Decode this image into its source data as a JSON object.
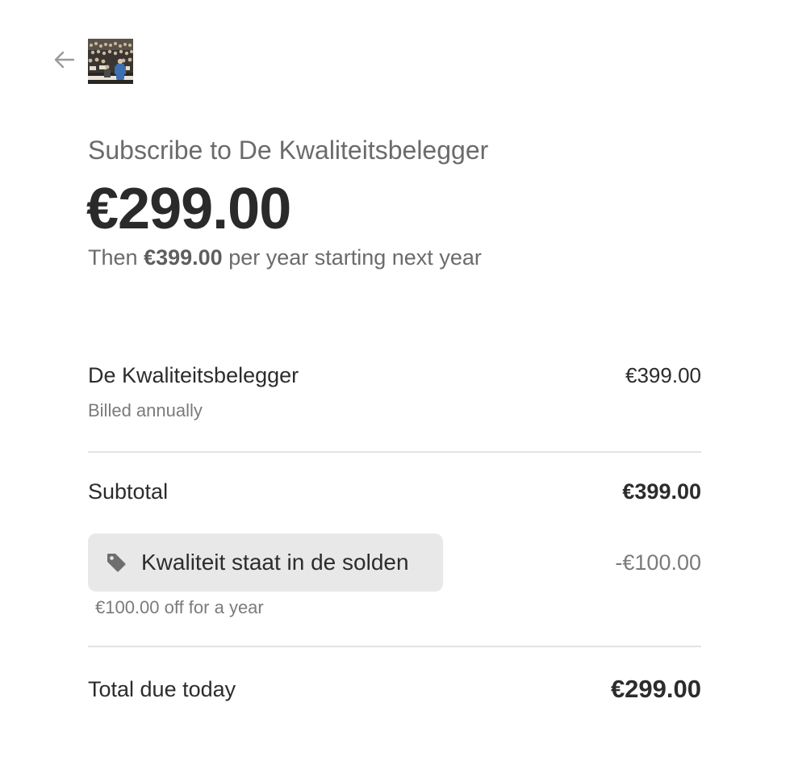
{
  "header": {
    "back_icon": "arrow-left-icon",
    "logo_icon": "crowd-photo-logo"
  },
  "summary": {
    "subscribe_title": "Subscribe to De Kwaliteitsbelegger",
    "price": "€299.00",
    "then_prefix": "Then",
    "then_amount": "€399.00",
    "then_suffix": "per year starting next year"
  },
  "line_item": {
    "name": "De Kwaliteitsbelegger",
    "amount": "€399.00",
    "billing": "Billed annually"
  },
  "subtotal": {
    "label": "Subtotal",
    "amount": "€399.00"
  },
  "promo": {
    "icon": "tag-icon",
    "code": "Kwaliteit staat in de solden",
    "discount": "-€100.00",
    "note": "€100.00 off for a year"
  },
  "total": {
    "label": "Total due today",
    "amount": "€299.00"
  },
  "colors": {
    "chip_background": "#e8e8e8",
    "divider": "#e3e3e3",
    "muted_text": "#7b7b7b"
  }
}
